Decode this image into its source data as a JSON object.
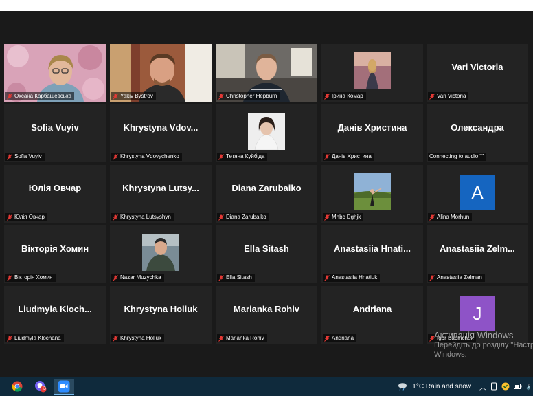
{
  "tiles": [
    {
      "label": "Оксана Карбашевська",
      "kind": "photo",
      "active": true
    },
    {
      "label": "Yakiv Bystrov",
      "kind": "photo"
    },
    {
      "label": "Christopher Hepburn",
      "kind": "photo"
    },
    {
      "label": "Ірина Комар",
      "kind": "thumb"
    },
    {
      "label": "Vari Victoria",
      "big": "Vari Victoria",
      "kind": "name"
    },
    {
      "label": "Sofia Vuyiv",
      "big": "Sofia Vuyiv",
      "kind": "name"
    },
    {
      "label": "Khrystyna Vdovychenko",
      "big": "Khrystyna  Vdov...",
      "kind": "name"
    },
    {
      "label": "Тетяна Куйбіда",
      "kind": "thumb"
    },
    {
      "label": "Данів Христина",
      "big": "Данів Христина",
      "kind": "name"
    },
    {
      "label": "Connecting to audio \"\"",
      "big": "Олександра",
      "kind": "name",
      "connecting": true
    },
    {
      "label": "Юлія Овчар",
      "big": "Юлія Овчар",
      "kind": "name"
    },
    {
      "label": "Khrystyna Lutsyshyn",
      "big": "Khrystyna  Lutsy...",
      "kind": "name"
    },
    {
      "label": "Diana Zarubaiko",
      "big": "Diana Zarubaiko",
      "kind": "name"
    },
    {
      "label": "Mnbc Dghjk",
      "kind": "thumb"
    },
    {
      "label": "Alina Morhun",
      "kind": "avatar",
      "initial": "A",
      "color": "#1565c0"
    },
    {
      "label": "Вікторія Хомин",
      "big": "Вікторія Хомин",
      "kind": "name"
    },
    {
      "label": "Nazar Muzychka",
      "kind": "thumb"
    },
    {
      "label": "Ella Sitash",
      "big": "Ella Sitash",
      "kind": "name"
    },
    {
      "label": "Anastasiia Hnatiuk",
      "big": "Anastasiia  Hnati...",
      "kind": "name"
    },
    {
      "label": "Anastasiia Zelman",
      "big": "Anastasiia  Zelm...",
      "kind": "name"
    },
    {
      "label": "Liudmyla Klochana",
      "big": "Liudmyla  Kloch...",
      "kind": "name"
    },
    {
      "label": "Khrystyna Holiuk",
      "big": "Khrystyna Holiuk",
      "kind": "name"
    },
    {
      "label": "Marianka Rohiv",
      "big": "Marianka Rohiv",
      "kind": "name"
    },
    {
      "label": "Andriana",
      "big": "Andriana",
      "kind": "name"
    },
    {
      "label": "Igor Babinchuk",
      "kind": "avatar",
      "initial": "J",
      "color": "#8e53c7"
    }
  ],
  "watermark": {
    "title": "Активація Windows",
    "line1": "Перейдіть до розділу \"Настройки\"",
    "line2": "Windows."
  },
  "taskbar": {
    "weather": "1°C  Rain and snow",
    "apps": [
      "chrome-icon",
      "viber-icon",
      "zoom-icon"
    ],
    "viber_badge": "3"
  },
  "colors": {
    "active_border": "#c9e56c",
    "muted_mic": "#e53935",
    "avatar_a": "#1565c0",
    "avatar_j": "#8e53c7"
  }
}
